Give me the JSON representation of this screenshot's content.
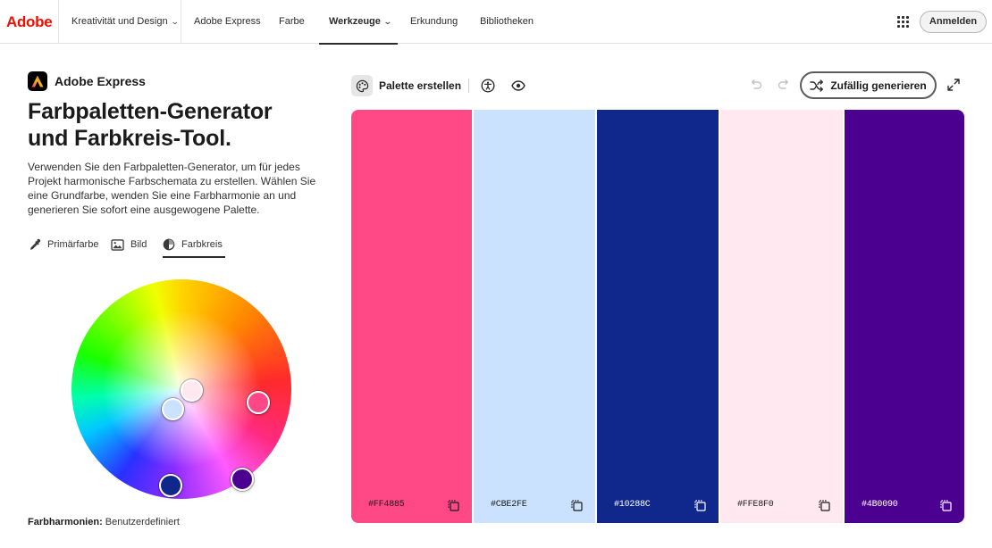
{
  "nav": {
    "brand": "Adobe",
    "items": [
      {
        "label": "Kreativität und Design",
        "has_chevron": true
      },
      {
        "label": "Adobe Express",
        "has_chevron": false
      },
      {
        "label": "Farbe",
        "has_chevron": false
      },
      {
        "label": "Werkzeuge",
        "has_chevron": true,
        "active": true
      },
      {
        "label": "Erkundung",
        "has_chevron": false
      },
      {
        "label": "Bibliotheken",
        "has_chevron": false
      }
    ],
    "apps_icon": "apps-grid-icon",
    "signin_label": "Anmelden"
  },
  "left": {
    "product_name": "Adobe Express",
    "title_line1": "Farbpaletten-Generator",
    "title_line2": "und Farbkreis-Tool.",
    "description": "Verwenden Sie den Farbpaletten-Generator, um für jedes Projekt harmonische Farbschemata zu erstellen. Wählen Sie eine Grundfarbe, wenden Sie eine Farbharmonie an und generieren Sie sofort eine ausgewogene Palette.",
    "tabs": [
      {
        "label": "Primärfarbe",
        "icon": "eyedropper-icon"
      },
      {
        "label": "Bild",
        "icon": "image-icon"
      },
      {
        "label": "Farbkreis",
        "icon": "color-wheel-icon",
        "active": true
      }
    ],
    "harmony_label": "Farbharmonien:",
    "harmony_value": "Benutzerdefiniert"
  },
  "toolbar": {
    "palette_label": "Palette erstellen",
    "random_label": "Zufällig generieren"
  },
  "colors": {
    "brand_red": "#EB1000",
    "accent_dark": "#2C2C2C"
  },
  "palette": [
    {
      "hex": "#FF4885",
      "text_color": "#1b1b1b"
    },
    {
      "hex": "#CBE2FE",
      "text_color": "#1b1b1b"
    },
    {
      "hex": "#10288C",
      "text_color": "#ffffff"
    },
    {
      "hex": "#FFE8F0",
      "text_color": "#1b1b1b"
    },
    {
      "hex": "#4B0090",
      "text_color": "#ffffff"
    }
  ]
}
